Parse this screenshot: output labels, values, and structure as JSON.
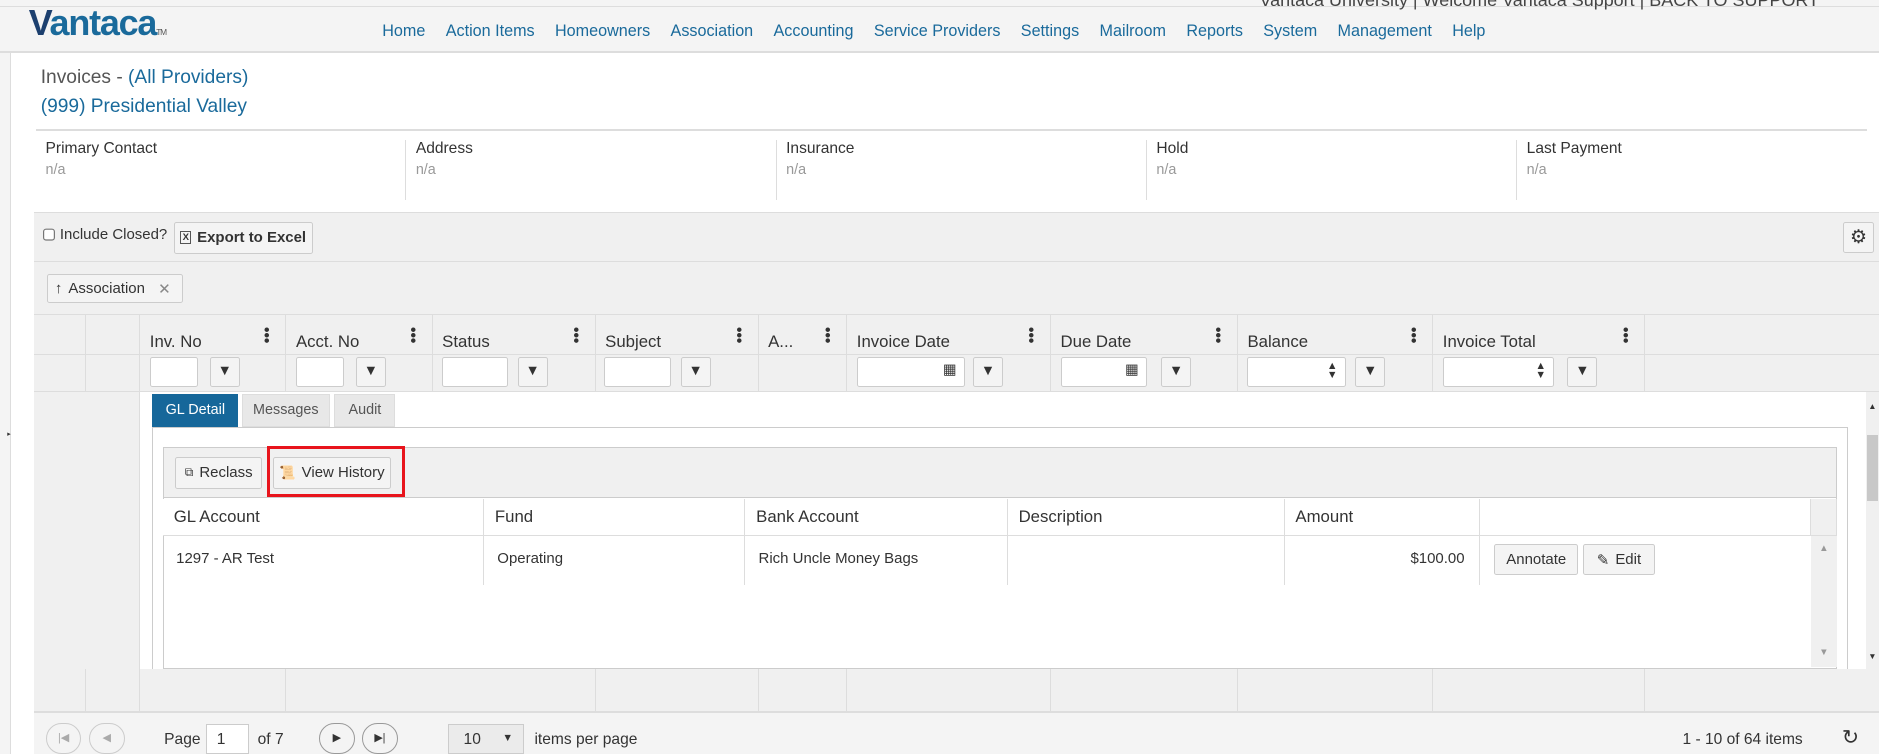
{
  "header": {
    "logo": "Vantaca",
    "welcome": "Vantaca University | Welcome Vantaca Support | BACK TO SUPPORT",
    "nav": [
      "Home",
      "Action Items",
      "Homeowners",
      "Association",
      "Accounting",
      "Service Providers",
      "Settings",
      "Mailroom",
      "Reports",
      "System",
      "Management",
      "Help"
    ]
  },
  "page": {
    "title_prefix": "Invoices - ",
    "title_link": "(All Providers)",
    "subtitle": "(999) Presidential Valley"
  },
  "info": [
    {
      "label": "Primary Contact",
      "value": "n/a"
    },
    {
      "label": "Address",
      "value": "n/a"
    },
    {
      "label": "Insurance",
      "value": "n/a"
    },
    {
      "label": "Hold",
      "value": "n/a"
    },
    {
      "label": "Last Payment",
      "value": "n/a"
    }
  ],
  "toolbar": {
    "include_closed": "Include Closed?",
    "export": "Export to Excel",
    "group_chip": "Association"
  },
  "columns": [
    "Inv. No",
    "Acct. No",
    "Status",
    "Subject",
    "A...",
    "Invoice Date",
    "Due Date",
    "Balance",
    "Invoice Total"
  ],
  "detail": {
    "tabs": [
      "GL Detail",
      "Messages",
      "Audit"
    ],
    "reclass": "Reclass",
    "view_history": "View History",
    "headers": [
      "GL Account",
      "Fund",
      "Bank Account",
      "Description",
      "Amount"
    ],
    "row": {
      "gl_account": "1297 - AR Test",
      "fund": "Operating",
      "bank_account": "Rich Uncle Money Bags",
      "description": "",
      "amount": "$100.00",
      "annotate": "Annotate",
      "edit": "Edit"
    }
  },
  "pager": {
    "page_label": "Page",
    "page": "1",
    "of": "of 7",
    "page_size": "10",
    "per_page": "items per page",
    "summary": "1 - 10 of 64 items"
  },
  "colors": {
    "accent": "#1a6a9b",
    "highlight": "#e8141c"
  }
}
